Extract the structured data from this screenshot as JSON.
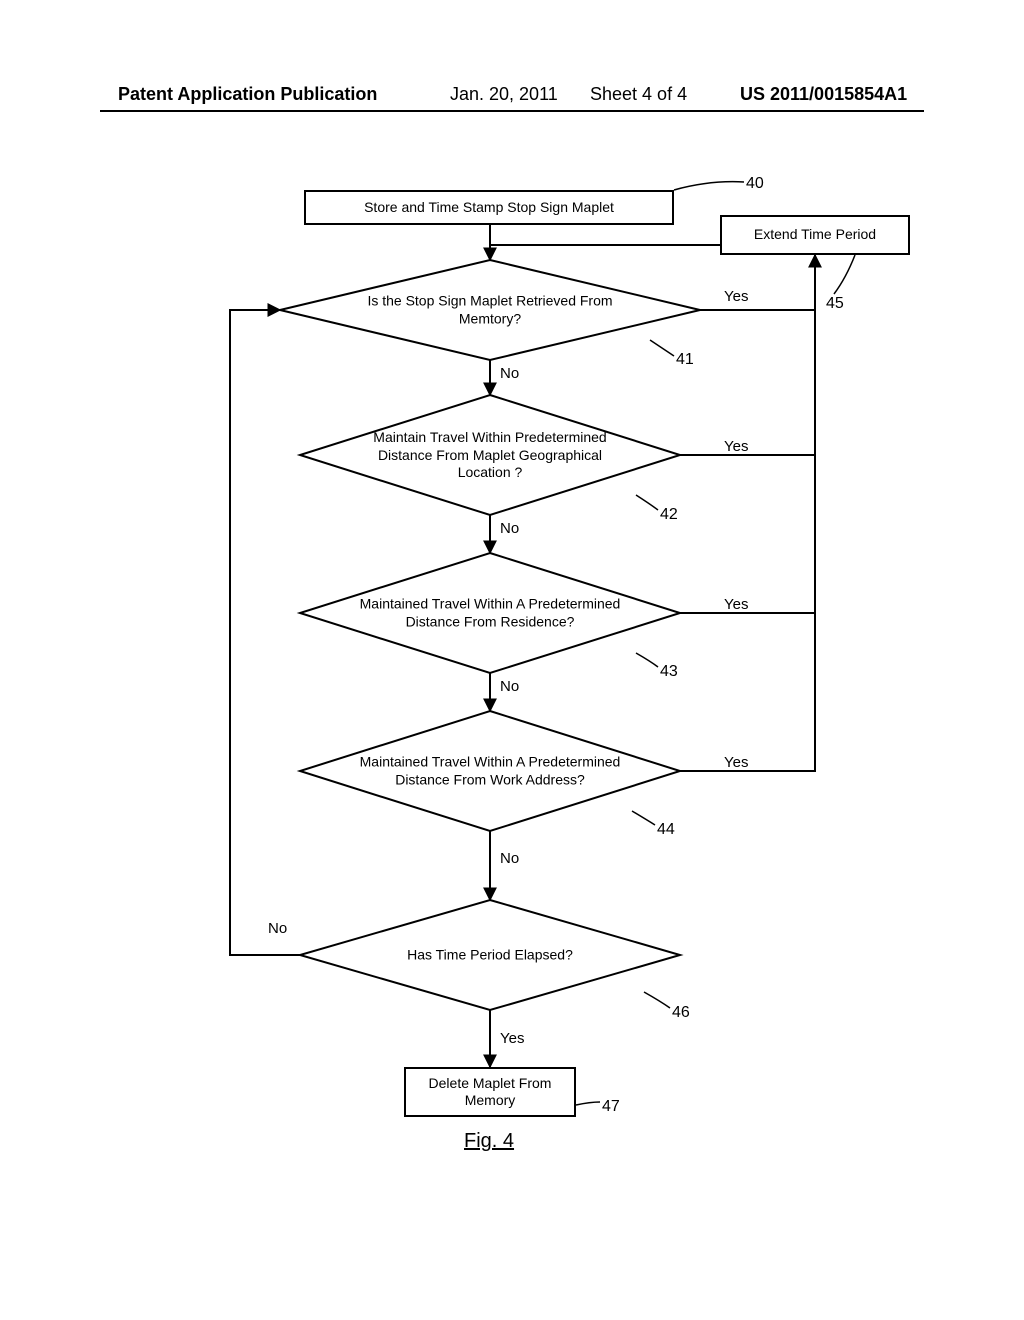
{
  "header": {
    "left": "Patent Application Publication",
    "date": "Jan. 20, 2011",
    "sheet": "Sheet 4 of 4",
    "right": "US 2011/0015854A1"
  },
  "nodes": {
    "n40": "Store and Time Stamp Stop Sign Maplet",
    "n45": "Extend Time Period",
    "n41": "Is\nthe Stop Sign Maplet Retrieved From\nMemtory?",
    "n42": "Maintain\nTravel Within Predetermined\nDistance From Maplet Geographical\nLocation ?",
    "n43": "Maintained\nTravel Within A\nPredetermined Distance From\nResidence?",
    "n44": "Maintained\nTravel Within A Predetermined\nDistance From Work\nAddress?",
    "n46": "Has Time Period Elapsed?",
    "n47": "Delete Maplet From\nMemory"
  },
  "refs": {
    "r40": "40",
    "r41": "41",
    "r42": "42",
    "r43": "43",
    "r44": "44",
    "r45": "45",
    "r46": "46",
    "r47": "47"
  },
  "labels": {
    "yes": "Yes",
    "no": "No"
  },
  "figure": "Fig. 4",
  "chart_data": {
    "type": "flowchart",
    "title": "Fig. 4",
    "nodes": [
      {
        "id": "40",
        "kind": "process",
        "text": "Store and Time Stamp Stop Sign Maplet"
      },
      {
        "id": "41",
        "kind": "decision",
        "text": "Is the Stop Sign Maplet Retrieved From Memtory?"
      },
      {
        "id": "42",
        "kind": "decision",
        "text": "Maintain Travel Within Predetermined Distance From Maplet Geographical Location ?"
      },
      {
        "id": "43",
        "kind": "decision",
        "text": "Maintained Travel Within A Predetermined Distance From Residence?"
      },
      {
        "id": "44",
        "kind": "decision",
        "text": "Maintained Travel Within A Predetermined Distance From Work Address?"
      },
      {
        "id": "45",
        "kind": "process",
        "text": "Extend Time Period"
      },
      {
        "id": "46",
        "kind": "decision",
        "text": "Has Time Period Elapsed?"
      },
      {
        "id": "47",
        "kind": "process",
        "text": "Delete Maplet From Memory"
      }
    ],
    "edges": [
      {
        "from": "40",
        "to": "41",
        "label": ""
      },
      {
        "from": "41",
        "to": "45",
        "label": "Yes"
      },
      {
        "from": "41",
        "to": "42",
        "label": "No"
      },
      {
        "from": "42",
        "to": "45",
        "label": "Yes"
      },
      {
        "from": "42",
        "to": "43",
        "label": "No"
      },
      {
        "from": "43",
        "to": "45",
        "label": "Yes"
      },
      {
        "from": "43",
        "to": "44",
        "label": "No"
      },
      {
        "from": "44",
        "to": "45",
        "label": "Yes"
      },
      {
        "from": "44",
        "to": "46",
        "label": "No"
      },
      {
        "from": "45",
        "to": "41",
        "label": ""
      },
      {
        "from": "46",
        "to": "41",
        "label": "No"
      },
      {
        "from": "46",
        "to": "47",
        "label": "Yes"
      }
    ]
  }
}
